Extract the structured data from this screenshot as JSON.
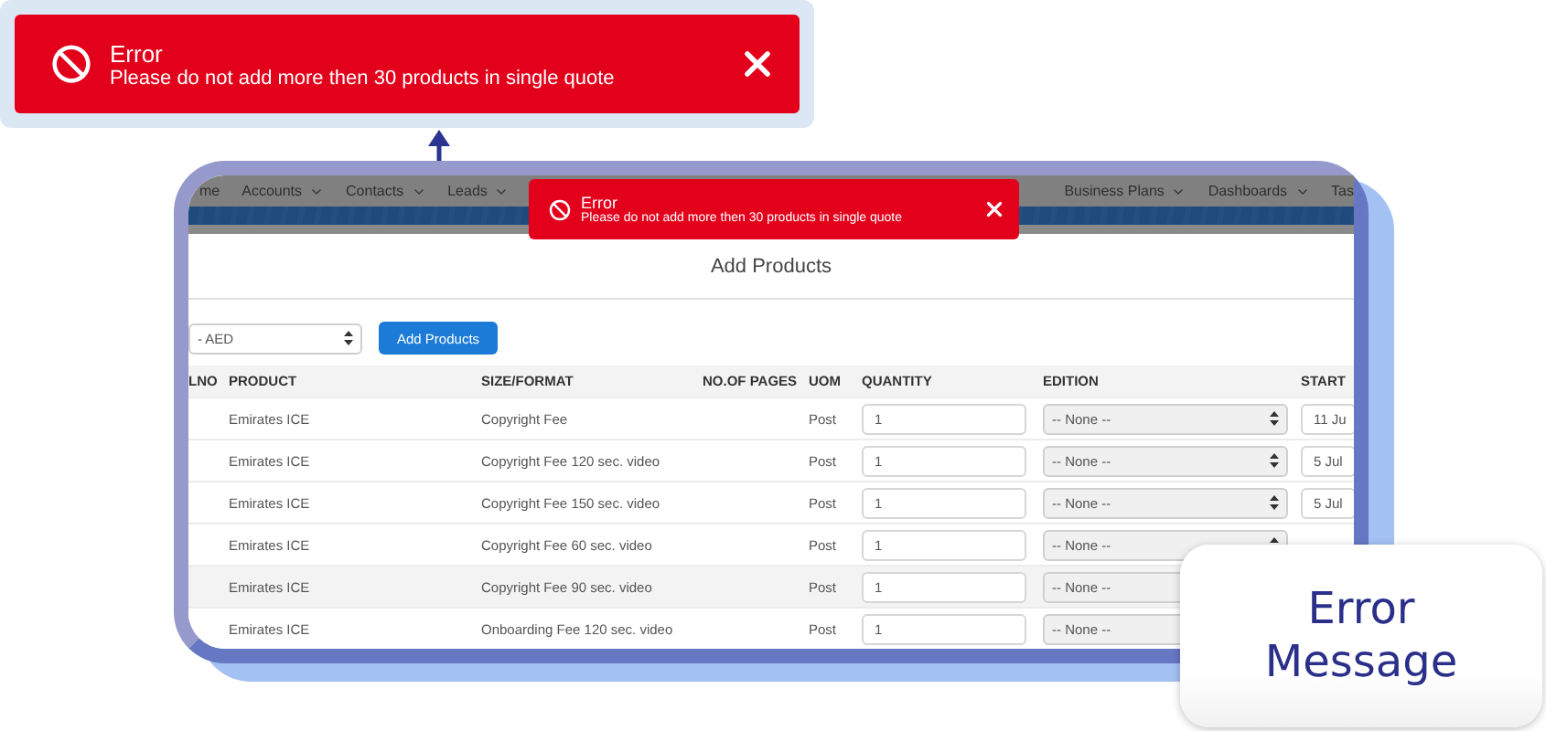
{
  "big_toast": {
    "title": "Error",
    "message": "Please do not add more then 30 products in single quote"
  },
  "nav": {
    "left": [
      {
        "label": "me",
        "dropdown": false
      },
      {
        "label": "Accounts",
        "dropdown": true
      },
      {
        "label": "Contacts",
        "dropdown": true
      },
      {
        "label": "Leads",
        "dropdown": true
      }
    ],
    "right": [
      {
        "label": "Business Plans",
        "dropdown": true
      },
      {
        "label": "Dashboards",
        "dropdown": true
      },
      {
        "label": "Tas",
        "dropdown": false
      }
    ]
  },
  "small_toast": {
    "title": "Error",
    "message": "Please do not add more then 30 products in single quote"
  },
  "page_title": "Add Products",
  "currency_select": {
    "value": "- AED"
  },
  "add_button": "Add Products",
  "table": {
    "columns": [
      "LNO",
      "PRODUCT",
      "SIZE/FORMAT",
      "NO.OF PAGES",
      "UOM",
      "QUANTITY",
      "EDITION",
      "START"
    ],
    "rows": [
      {
        "product": "Emirates ICE",
        "size_format": "Copyright Fee",
        "uom": "Post",
        "quantity": "1",
        "edition": "-- None --",
        "start": "11 Ju"
      },
      {
        "product": "Emirates ICE",
        "size_format": "Copyright Fee 120 sec. video",
        "uom": "Post",
        "quantity": "1",
        "edition": "-- None --",
        "start": "5 Jul"
      },
      {
        "product": "Emirates ICE",
        "size_format": "Copyright Fee 150 sec. video",
        "uom": "Post",
        "quantity": "1",
        "edition": "-- None --",
        "start": "5 Jul"
      },
      {
        "product": "Emirates ICE",
        "size_format": "Copyright Fee 60 sec. video",
        "uom": "Post",
        "quantity": "1",
        "edition": "-- None --"
      },
      {
        "product": "Emirates ICE",
        "size_format": "Copyright Fee 90 sec. video",
        "uom": "Post",
        "quantity": "1",
        "edition": "-- None --"
      },
      {
        "product": "Emirates ICE",
        "size_format": "Onboarding Fee 120 sec. video",
        "uom": "Post",
        "quantity": "1",
        "edition": "-- None --"
      }
    ]
  },
  "callout": "Error Message"
}
